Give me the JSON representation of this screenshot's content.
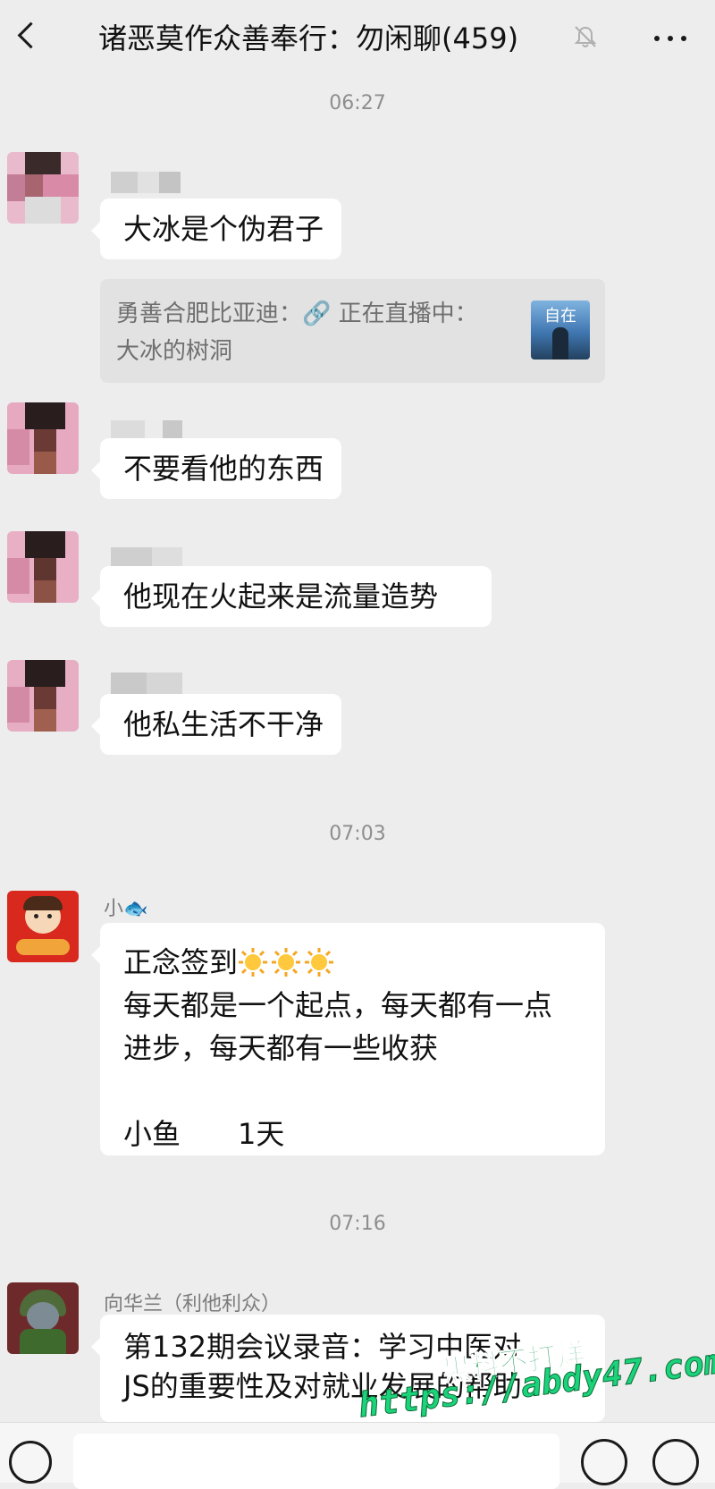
{
  "header": {
    "title": "诸恶莫作众善奉行：勿闲聊(459)",
    "back_icon": "chevron-left-icon",
    "mute_icon": "bell-off-icon",
    "more_icon": "more-dots-icon"
  },
  "messages": {
    "time1": "06:27",
    "msg1": "大冰是个伪君子",
    "quote": {
      "line1": "勇善合肥比亚迪：🔗 正在直播中：",
      "line2": "大冰的树洞",
      "thumb_text": "自在"
    },
    "msg2": "不要看他的东西",
    "msg3": "他现在火起来是流量造势",
    "msg4": "他私生活不干净",
    "time2": "07:03",
    "sender5": "小🐟",
    "msg5": {
      "line1": "正念签到",
      "line2": "每天都是一个起点，每天都有一点",
      "line3": "进步，每天都有一些收获",
      "line4": "小鱼　　1天"
    },
    "time3": "07:16",
    "sender6": "向华兰（利他利众）",
    "msg6": {
      "line1": "第132期会议录音：学习中医对",
      "line2": "JS的重要性及对就业发展的帮助"
    }
  },
  "bottom_bar": {
    "voice_icon": "voice-icon",
    "emoji_icon": "emoji-icon",
    "plus_icon": "plus-icon",
    "input_value": ""
  },
  "watermark": {
    "line1": "黑料不打烊",
    "line2": "https://abdy47.com"
  },
  "colors": {
    "background": "#ededed",
    "bubble": "#ffffff",
    "quote_bg": "#e2e2e2",
    "watermark_green": "#1bd37a"
  }
}
